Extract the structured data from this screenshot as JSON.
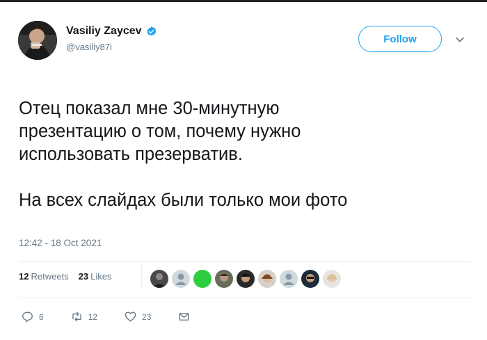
{
  "colors": {
    "accent": "#1da1f2",
    "muted": "#657786",
    "text": "#14171a"
  },
  "user": {
    "name": "Vasiliy Zaycev",
    "handle": "@vasiliy87i",
    "verified": true
  },
  "follow_label": "Follow",
  "tweet": {
    "text": "Отец показал мне 30-минутную\nпрезентацию о том, почему нужно\nиспользовать презерватив.\n\nНа всех слайдах были только мои фото",
    "timestamp": "12:42 - 18 Oct 2021"
  },
  "stats": {
    "retweets_count": "12",
    "retweets_label": "Retweets",
    "likes_count": "23",
    "likes_label": "Likes"
  },
  "actions": {
    "reply_count": "6",
    "retweet_count": "12",
    "like_count": "23"
  },
  "icons": [
    "verified-icon",
    "chevron-down-icon",
    "reply-icon",
    "retweet-icon",
    "like-icon",
    "direct-message-icon"
  ]
}
